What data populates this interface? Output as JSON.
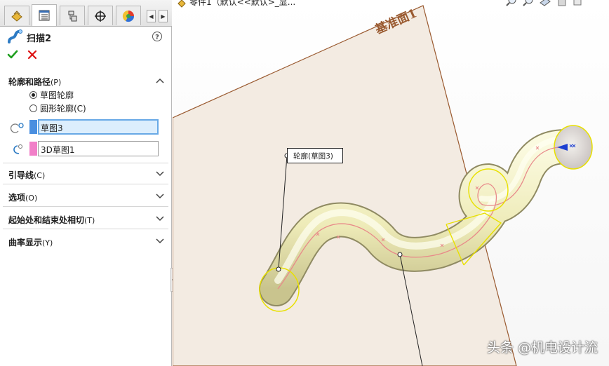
{
  "property_manager": {
    "feature_title": "扫描2",
    "sections": {
      "profile_and_path": {
        "label": "轮廓和路径",
        "shortcut": "(P)",
        "expanded": true
      },
      "guide_curves": {
        "label": "引导线",
        "shortcut": "(C)",
        "expanded": false
      },
      "options": {
        "label": "选项",
        "shortcut": "(O)",
        "expanded": false
      },
      "start_end_tangency": {
        "label": "起始处和结束处相切",
        "shortcut": "(T)",
        "expanded": false
      },
      "curvature_display": {
        "label": "曲率显示",
        "shortcut": "(Y)",
        "expanded": false
      }
    },
    "profile_type": {
      "options": [
        "草图轮廓",
        "圆形轮廓(C)"
      ],
      "selected": "草图轮廓"
    },
    "profile_selection": {
      "value": "草图3",
      "swatch_color": "#4a8fe0"
    },
    "path_selection": {
      "value": "3D草图1",
      "swatch_color": "#f17fc8"
    }
  },
  "graphics": {
    "document_title": "零件1（默认<<默认>_显...",
    "plane_label": "基准面1",
    "callout_label": "轮廓(草图3)",
    "watermark": "头条 @机电设计流"
  },
  "colors": {
    "accent": "#68a9e6",
    "ok": "#1e9e1e",
    "cancel": "#d11",
    "plane_edge": "#9a5a30",
    "tube": "#f3f0bf",
    "preview_edge": "#e8e000",
    "path_curve": "#e88a8a"
  },
  "icons": {
    "tabs": [
      "feature-manager-icon",
      "property-manager-icon",
      "configuration-manager-icon",
      "dimxpert-icon",
      "display-manager-icon"
    ],
    "ok": "checkmark-icon",
    "cancel": "x-icon",
    "help": "help-icon"
  }
}
